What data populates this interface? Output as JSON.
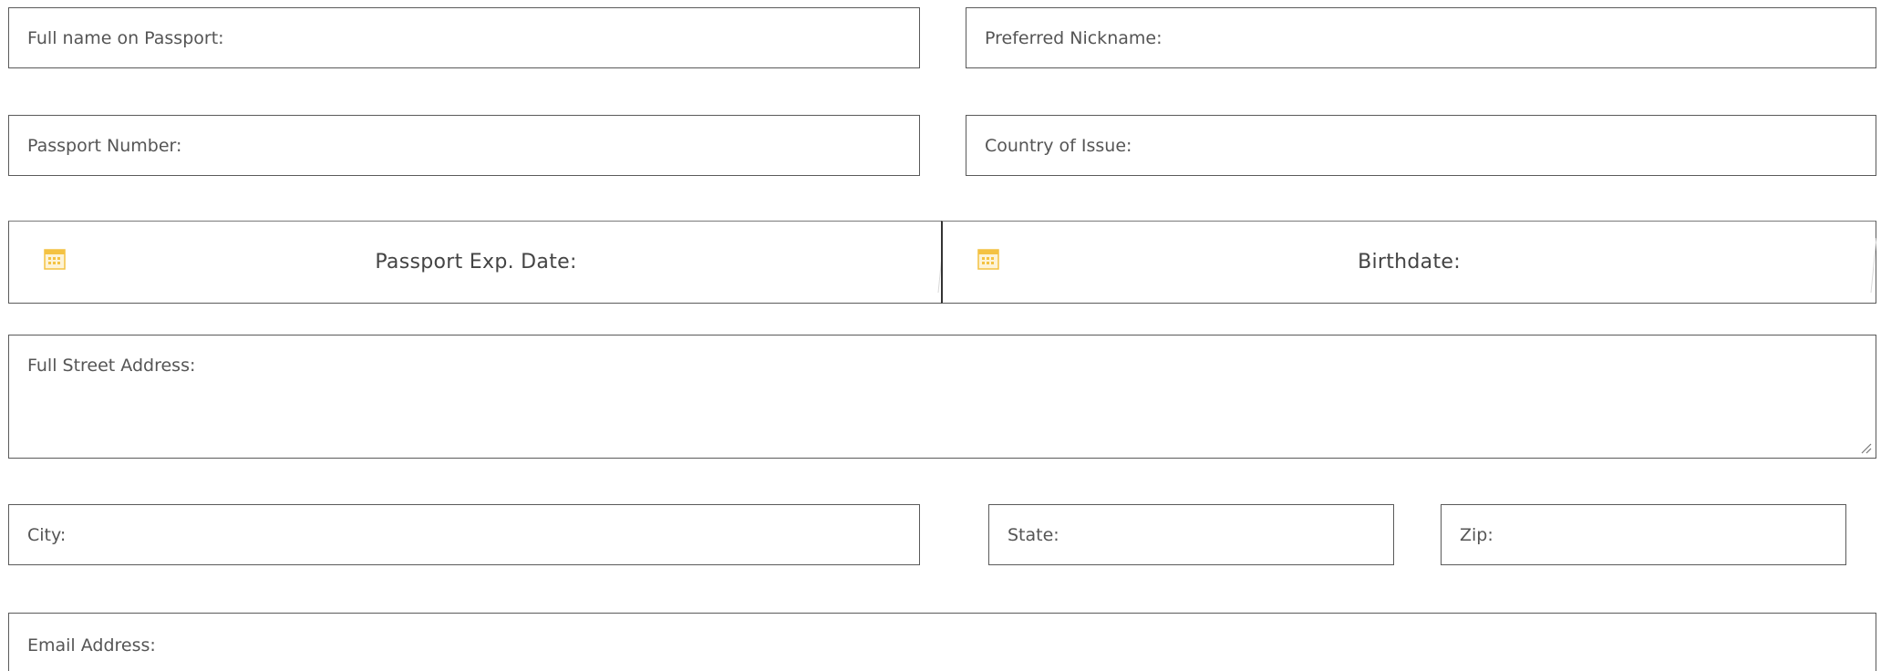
{
  "form": {
    "full_name_placeholder": "Full name on Passport:",
    "nickname_placeholder": "Preferred Nickname:",
    "passport_number_placeholder": "Passport Number:",
    "country_placeholder": "Country of Issue:",
    "passport_exp_label": "Passport Exp. Date:",
    "birthdate_label": "Birthdate:",
    "street_placeholder": "Full Street Address:",
    "city_placeholder": "City:",
    "state_placeholder": "State:",
    "zip_placeholder": "Zip:",
    "email_placeholder": "Email Address:"
  },
  "icons": {
    "date_picker_icon": "calendar-icon",
    "resize_icon": "resize-grip-icon"
  },
  "colors": {
    "border": "#5a5a5a",
    "placeholder_text": "#555555",
    "calendar_icon": "#f4c242"
  }
}
